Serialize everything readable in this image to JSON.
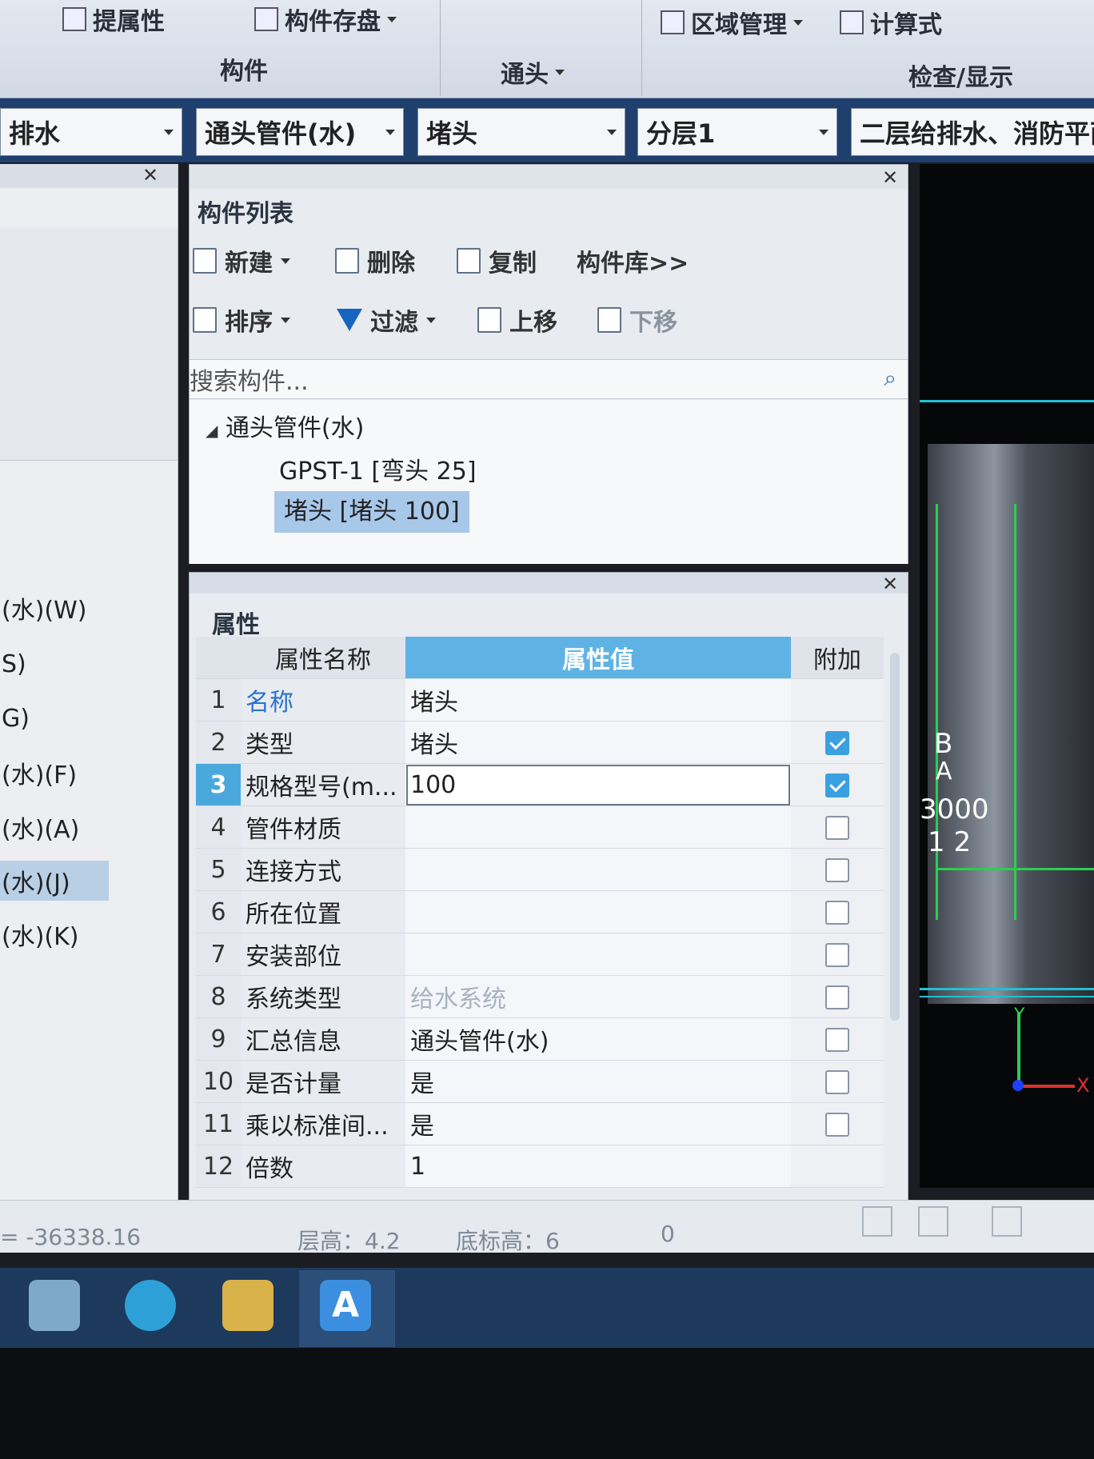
{
  "ribbon": {
    "btn_extract_prop": "提属性",
    "btn_save_component": "构件存盘",
    "group_component": "构件",
    "group_fitting": "通头",
    "btn_area_manage": "区域管理",
    "btn_formula": "计算式",
    "group_check": "检查/显示"
  },
  "combos": {
    "system": "排水",
    "category": "通头管件(水)",
    "component": "堵头",
    "floor": "分层1",
    "drawing": "二层给排水、消防平面"
  },
  "left_nav": {
    "items": [
      {
        "label": "(水)(W)"
      },
      {
        "label": "S)"
      },
      {
        "label": "G)"
      },
      {
        "label": "(水)(F)"
      },
      {
        "label": "(水)(A)"
      },
      {
        "label": "(水)(J)"
      },
      {
        "label": "(水)(K)"
      }
    ]
  },
  "component_list": {
    "title": "构件列表",
    "btn_new": "新建",
    "btn_delete": "删除",
    "btn_copy": "复制",
    "btn_library": "构件库>>",
    "btn_sort": "排序",
    "btn_filter": "过滤",
    "btn_move_up": "上移",
    "btn_move_down": "下移",
    "search_placeholder": "搜索构件...",
    "tree_root": "通头管件(水)",
    "tree_items": [
      "GPST-1 [弯头 25]",
      "堵头 [堵头 100]"
    ]
  },
  "properties": {
    "title": "属性",
    "col_name": "属性名称",
    "col_value": "属性值",
    "col_extra": "附加",
    "rows": [
      {
        "num": "1",
        "name": "名称",
        "value": "堵头",
        "checked": null
      },
      {
        "num": "2",
        "name": "类型",
        "value": "堵头",
        "checked": true
      },
      {
        "num": "3",
        "name": "规格型号(m...",
        "value": "100",
        "checked": true
      },
      {
        "num": "4",
        "name": "管件材质",
        "value": "",
        "checked": false
      },
      {
        "num": "5",
        "name": "连接方式",
        "value": "",
        "checked": false
      },
      {
        "num": "6",
        "name": "所在位置",
        "value": "",
        "checked": false
      },
      {
        "num": "7",
        "name": "安装部位",
        "value": "",
        "checked": false
      },
      {
        "num": "8",
        "name": "系统类型",
        "value": "给水系统",
        "checked": false
      },
      {
        "num": "9",
        "name": "汇总信息",
        "value": "通头管件(水)",
        "checked": false
      },
      {
        "num": "10",
        "name": "是否计量",
        "value": "是",
        "checked": false
      },
      {
        "num": "11",
        "name": "乘以标准间...",
        "value": "是",
        "checked": false
      },
      {
        "num": "12",
        "name": "倍数",
        "value": "1",
        "checked": null
      }
    ]
  },
  "cad": {
    "label_b": "B",
    "label_a": "A",
    "label_dim": "3000",
    "label_grid": "1 2",
    "axis_y": "Y",
    "axis_x": "X"
  },
  "status": {
    "coord": "= -36338.16",
    "floor_height": "层高：4.2",
    "base_elevation": "底标高：6",
    "extra": "0"
  },
  "colors": {
    "accent": "#4aa8dc",
    "header_value": "#5fb3e4",
    "selection": "#a8c8ea",
    "link": "#2a73c9"
  }
}
